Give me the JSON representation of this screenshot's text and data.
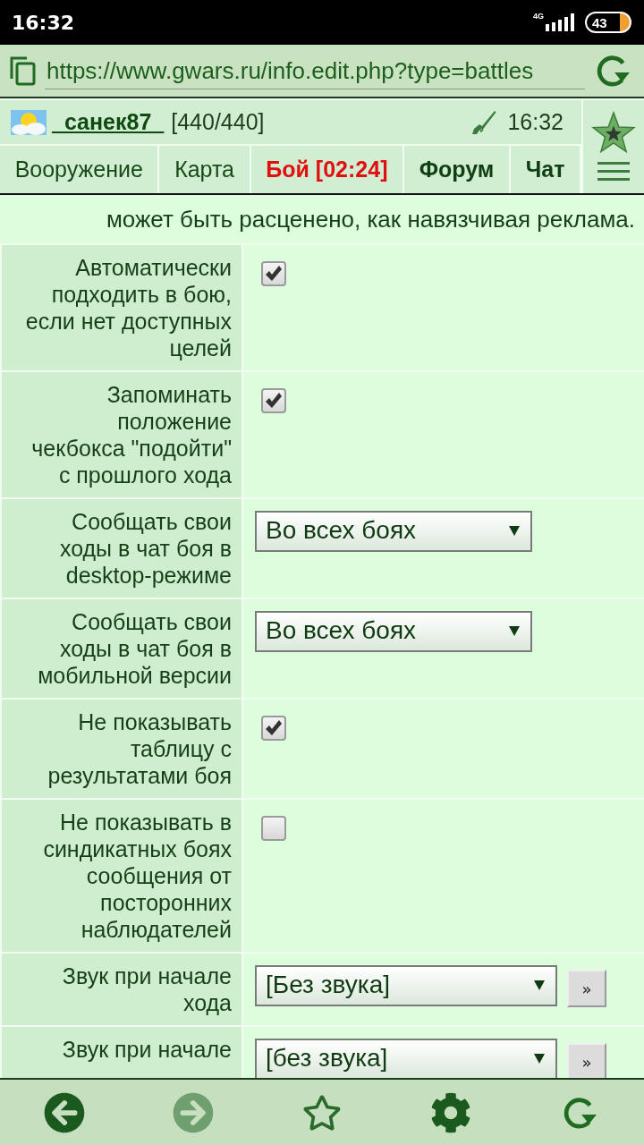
{
  "status_bar": {
    "time": "16:32",
    "network": "4G",
    "battery": "43"
  },
  "address_bar": {
    "url": "https://www.gwars.ru/info.edit.php?type=battles"
  },
  "header": {
    "username": "_санек87_",
    "health": "[440/440]",
    "time": "16:32"
  },
  "nav_tabs": [
    {
      "label": "Вооружение",
      "kind": "normal"
    },
    {
      "label": "Карта",
      "kind": "normal"
    },
    {
      "label": "Бой [02:24]",
      "kind": "alert"
    },
    {
      "label": "Форум",
      "kind": "bold"
    },
    {
      "label": "Чат",
      "kind": "bold"
    }
  ],
  "notice": "может быть расценено, как навязчивая реклама.",
  "settings": [
    {
      "kind": "checkbox",
      "label": "Автоматически подходить в бою, если нет доступных целей",
      "checked": true
    },
    {
      "kind": "checkbox",
      "label": "Запоминать положение чекбокса \"подойти\" с прошлого хода",
      "checked": true
    },
    {
      "kind": "select",
      "label": "Сообщать свои ходы в чат боя в desktop-режиме",
      "value": "Во всех боях"
    },
    {
      "kind": "select",
      "label": "Сообщать свои ходы в чат боя в мобильной версии",
      "value": "Во всех боях"
    },
    {
      "kind": "checkbox",
      "label": "Не показывать таблицу с результатами боя",
      "checked": true
    },
    {
      "kind": "checkbox",
      "label": "Не показывать в синдикатных боях сообщения от посторонних наблюдателей",
      "checked": false
    },
    {
      "kind": "sound",
      "label": "Звук при начале хода",
      "value": "[Без звука]",
      "button": "»"
    },
    {
      "kind": "sound",
      "label": "Звук при начале",
      "value": "[без звука]",
      "button": "»"
    }
  ],
  "bottom_bar": {
    "back_disabled": false,
    "forward_disabled": true
  }
}
